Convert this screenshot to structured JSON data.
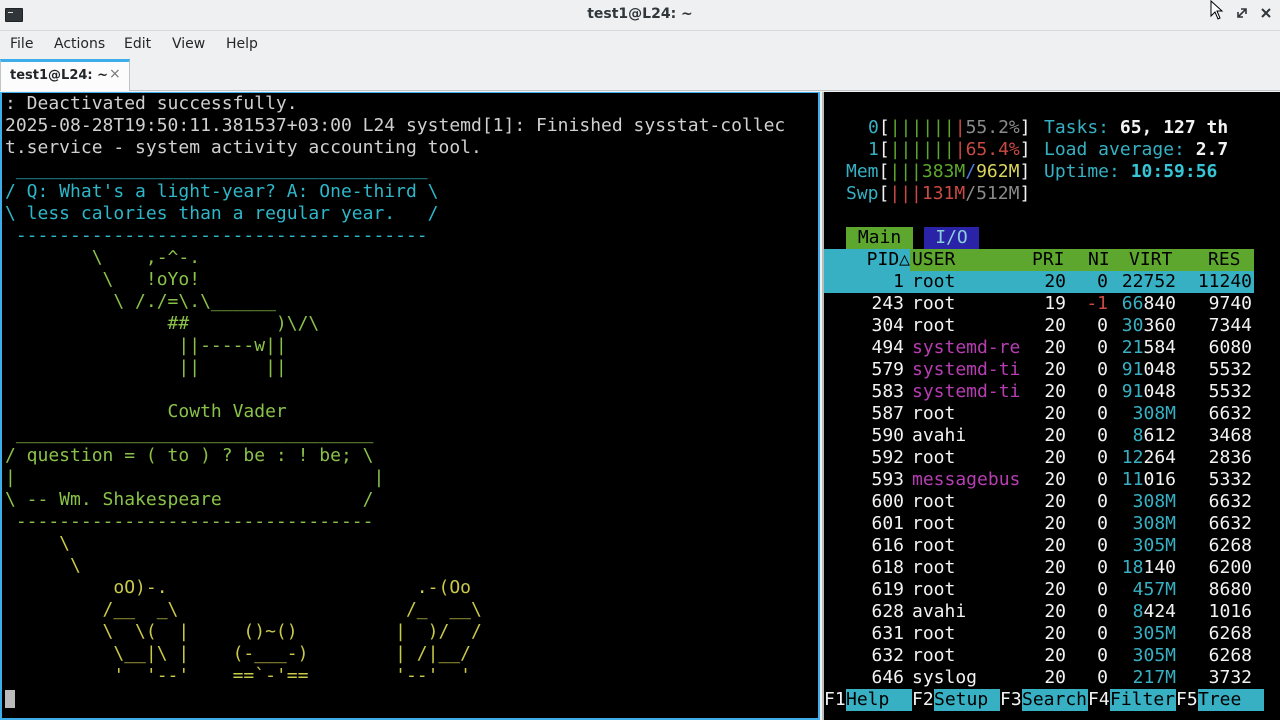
{
  "window": {
    "title": "test1@L24: ~",
    "minimize": "–",
    "maximize": "⤢",
    "close": "✖"
  },
  "menu": {
    "file": "File",
    "actions": "Actions",
    "edit": "Edit",
    "view": "View",
    "help": "Help"
  },
  "tab": {
    "label": "test1@L24: ~",
    "close": "×"
  },
  "left": {
    "l1": ": Deactivated successfully.",
    "l2": "2025-08-28T19:50:11.381537+03:00 L24 systemd[1]: Finished sysstat-collec",
    "l3": "t.service - system activity accounting tool.",
    "c1": " ______________________________________",
    "c2": "/ Q: What's a light-year? A: One-third \\",
    "c3": "\\ less calories than a regular year.   /",
    "c4": " --------------------------------------",
    "v1": "        \\    ,-^-.",
    "v2": "         \\   !oYo!",
    "v3": "          \\ /./=\\.\\______",
    "v4": "               ##        )\\/\\",
    "v5": "                ||-----w||",
    "v6": "                ||      ||",
    "v7": "",
    "v8": "               Cowth Vader",
    "s1": " _________________________________",
    "s2": "/ question = ( to ) ? be : ! be; \\",
    "s3": "|                                 |",
    "s4": "\\ -- Wm. Shakespeare             /",
    "s5": " ---------------------------------",
    "o1": "     \\",
    "o2": "      \\",
    "o3": "          oO)-.                       .-(Oo",
    "o4": "         /__  _\\                     /_  __\\",
    "o5": "         \\  \\(  |     ()~()         |  )/  /",
    "o6": "          \\__|\\ |    (-___-)        | /|__/",
    "o7": "          '  '--'    ==`-'==        '--'  '"
  },
  "htop": {
    "cpu0_label": "0",
    "cpu0_bars": "||||||",
    "cpu0_val": "55.2%",
    "cpu0_pct": 55.2,
    "cpu1_label": "1",
    "cpu1_bars": "||||||",
    "cpu1_val": "65.4%",
    "cpu1_pct": 65.4,
    "mem_label": "Mem",
    "mem_bars": "|||",
    "mem_used": "383M",
    "mem_sep": "/",
    "mem_total": "962M",
    "swp_label": "Swp",
    "swp_bars": "|||",
    "swp_used": "131M",
    "swp_total": "512M",
    "tasks_label": "Tasks: ",
    "tasks": "65, 127 th",
    "load_label": "Load average: ",
    "load": "2.7",
    "uptime_label": "Uptime: ",
    "uptime": "10:59:56",
    "tab_main": "Main",
    "tab_io": "I/O",
    "headers": {
      "pid": "PID△",
      "user": "USER",
      "pri": "PRI",
      "ni": "NI",
      "virt": "VIRT",
      "res": "RES"
    },
    "rows": [
      {
        "pid": "1",
        "user": "root",
        "pri": "20",
        "ni": "0",
        "virt": "22752",
        "res": "11240"
      },
      {
        "pid": "243",
        "user": "root",
        "pri": "19",
        "ni": "-1",
        "virt": "66840",
        "res": "9740"
      },
      {
        "pid": "304",
        "user": "root",
        "pri": "20",
        "ni": "0",
        "virt": "30360",
        "res": "7344"
      },
      {
        "pid": "494",
        "user": "systemd-re",
        "pri": "20",
        "ni": "0",
        "virt": "21584",
        "res": "6080"
      },
      {
        "pid": "579",
        "user": "systemd-ti",
        "pri": "20",
        "ni": "0",
        "virt": "91048",
        "res": "5532"
      },
      {
        "pid": "583",
        "user": "systemd-ti",
        "pri": "20",
        "ni": "0",
        "virt": "91048",
        "res": "5532"
      },
      {
        "pid": "587",
        "user": "root",
        "pri": "20",
        "ni": "0",
        "virt": "308M",
        "res": "6632"
      },
      {
        "pid": "590",
        "user": "avahi",
        "pri": "20",
        "ni": "0",
        "virt": "8612",
        "res": "3468"
      },
      {
        "pid": "592",
        "user": "root",
        "pri": "20",
        "ni": "0",
        "virt": "12264",
        "res": "2836"
      },
      {
        "pid": "593",
        "user": "messagebus",
        "pri": "20",
        "ni": "0",
        "virt": "11016",
        "res": "5332"
      },
      {
        "pid": "600",
        "user": "root",
        "pri": "20",
        "ni": "0",
        "virt": "308M",
        "res": "6632"
      },
      {
        "pid": "601",
        "user": "root",
        "pri": "20",
        "ni": "0",
        "virt": "308M",
        "res": "6632"
      },
      {
        "pid": "616",
        "user": "root",
        "pri": "20",
        "ni": "0",
        "virt": "305M",
        "res": "6268"
      },
      {
        "pid": "618",
        "user": "root",
        "pri": "20",
        "ni": "0",
        "virt": "18140",
        "res": "6200"
      },
      {
        "pid": "619",
        "user": "root",
        "pri": "20",
        "ni": "0",
        "virt": "457M",
        "res": "8680"
      },
      {
        "pid": "628",
        "user": "avahi",
        "pri": "20",
        "ni": "0",
        "virt": "8424",
        "res": "1016"
      },
      {
        "pid": "631",
        "user": "root",
        "pri": "20",
        "ni": "0",
        "virt": "305M",
        "res": "6268"
      },
      {
        "pid": "632",
        "user": "root",
        "pri": "20",
        "ni": "0",
        "virt": "305M",
        "res": "6268"
      },
      {
        "pid": "646",
        "user": "syslog",
        "pri": "20",
        "ni": "0",
        "virt": "217M",
        "res": "3732"
      }
    ],
    "fkeys": [
      {
        "key": "F1",
        "label": "Help  "
      },
      {
        "key": "F2",
        "label": "Setup "
      },
      {
        "key": "F3",
        "label": "Search"
      },
      {
        "key": "F4",
        "label": "Filter"
      },
      {
        "key": "F5",
        "label": "Tree  "
      }
    ]
  },
  "colors": {
    "accent": "#3daee9",
    "cyan": "#36b0c2",
    "green": "#5da72e",
    "magenta": "#b73db3"
  }
}
